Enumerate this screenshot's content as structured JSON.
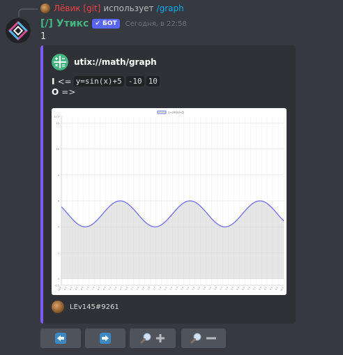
{
  "reply": {
    "author": "Лёвик [git]",
    "text": "использует",
    "command": "/graph"
  },
  "message": {
    "username": "[/] Утикс",
    "bot_tag": "✔ БОТ",
    "timestamp": "Сегодня, в 22:58",
    "content": "1"
  },
  "embed": {
    "author": "utix://math/graph",
    "input_label": "I",
    "input_arrow": "<=",
    "input_params": [
      "y=sin(x)+5",
      "-10",
      "10"
    ],
    "output_label": "O",
    "output_arrow": "=>",
    "footer": "LEv145#9261",
    "accent_color": "#7f5af0"
  },
  "buttons": [
    {
      "name": "prev",
      "icon": "arrow-left-icon"
    },
    {
      "name": "next",
      "icon": "arrow-right-icon"
    },
    {
      "name": "zoom-in",
      "icon": "zoom-in-icon"
    },
    {
      "name": "zoom-out",
      "icon": "zoom-out-icon"
    }
  ],
  "chart_data": {
    "type": "line",
    "legend": "y=sin(x)+5",
    "legend_position": "top",
    "x_range": [
      -10,
      10
    ],
    "ylim": [
      -0.5,
      12.5
    ],
    "grid": true,
    "fill": true,
    "line_color": "#6f6ff0",
    "fill_color": "#d6d6d6"
  }
}
